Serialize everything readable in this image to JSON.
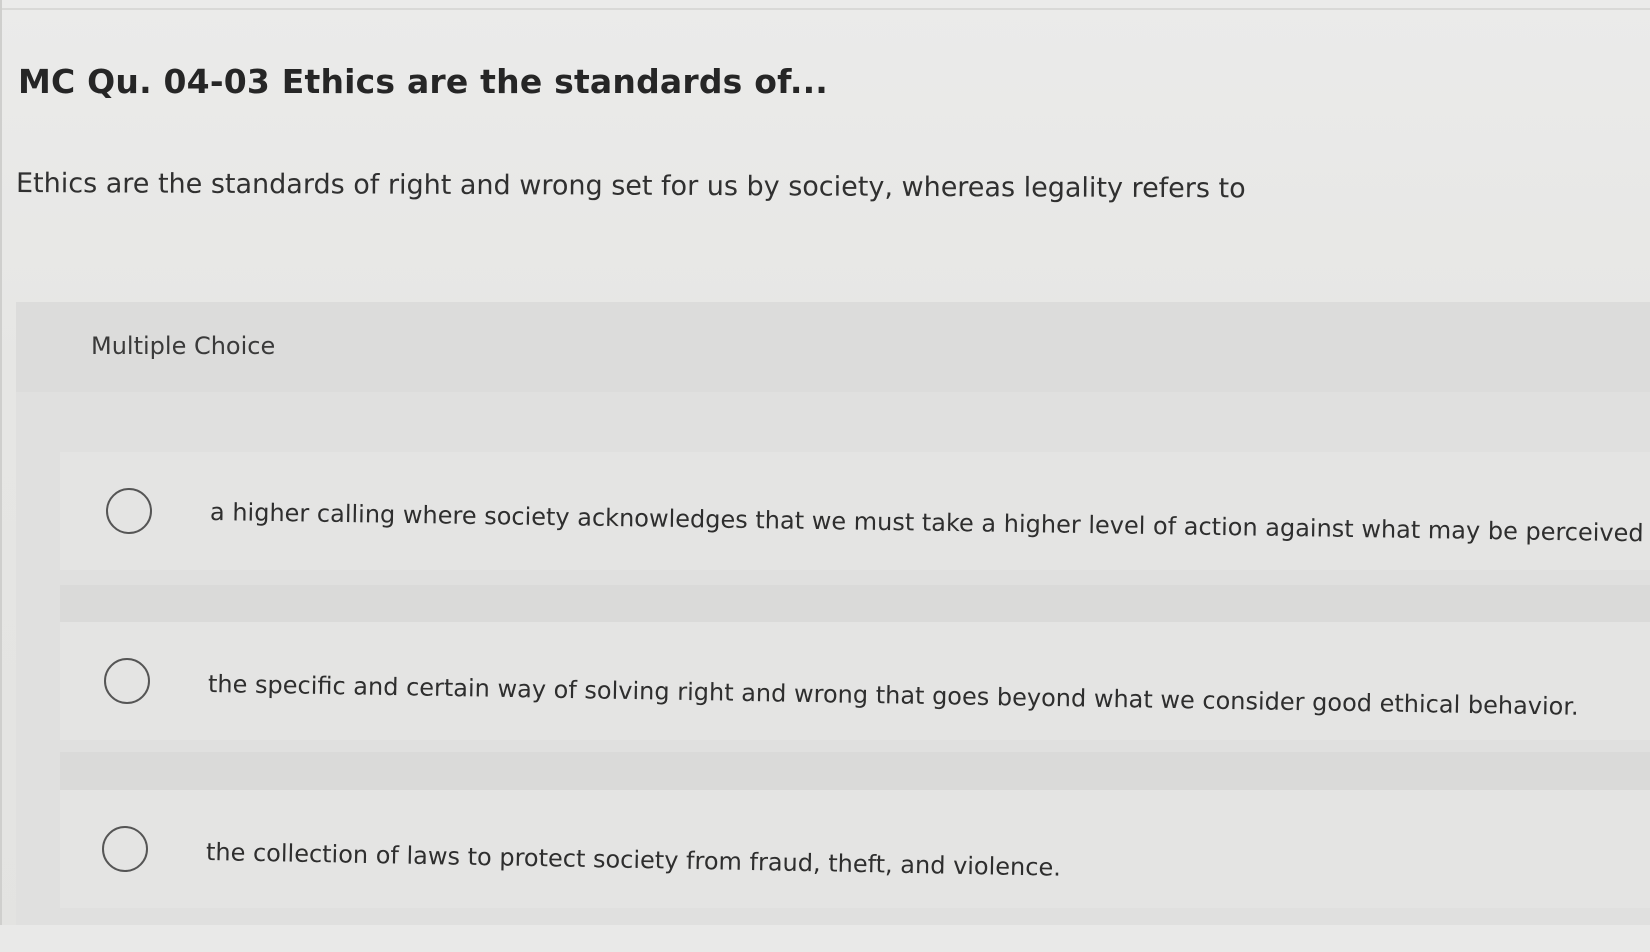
{
  "question": {
    "title": "MC Qu. 04-03 Ethics are the standards of...",
    "prompt": "Ethics are the standards of right and wrong set for us by society, whereas legality refers to"
  },
  "multiple_choice": {
    "label": "Multiple Choice",
    "options": [
      {
        "text": "a higher calling where society acknowledges that we must take a higher level of action against what may be perceived as",
        "selected": false
      },
      {
        "text": "the specific and certain way of solving right and wrong that goes beyond what we consider good ethical behavior.",
        "selected": false
      },
      {
        "text": "the collection of laws to protect society from fraud, theft, and violence.",
        "selected": false
      }
    ]
  }
}
